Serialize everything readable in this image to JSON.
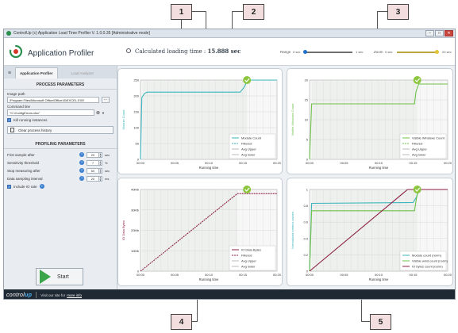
{
  "window": {
    "title": "ControlUp (c) Application Load Time Profiler  V. 1.0.0.35 [Administrative mode]"
  },
  "header": {
    "app_title": "Application Profiler",
    "calc_label": "Calculated loading time :",
    "calc_value": "15.888 sec",
    "range_label": "Range",
    "range_min": "0 sec",
    "range_max": "1 sec",
    "zoom_label": "Zoom",
    "zoom_min": "0 sec",
    "zoom_max": "20 sec"
  },
  "left": {
    "tab_active": "Application Profiler",
    "tab_inactive": "Load Analyzer",
    "process_title": "PROCESS PARAMETERS",
    "image_path_label": "Image path",
    "image_path_value": "\\Program Files\\Microsoft Office\\Office16\\EXCEL.EXE",
    "dots": "...",
    "cmd_label": "Command line",
    "cmd_value": "\"C:\\ConfigErrors.xlsx\"",
    "kill_label": "Kill running instances",
    "clear_label": "Clear process history",
    "profiling_title": "PROFILING PARAMETERS",
    "params": [
      {
        "label": "First sample after",
        "value": "20",
        "unit": "sec"
      },
      {
        "label": "Sensitivity threshold",
        "value": "7",
        "unit": "%"
      },
      {
        "label": "Stop measuring after",
        "value": "60",
        "unit": "sec"
      },
      {
        "label": "Data sampling interval",
        "value": "20",
        "unit": "ms"
      }
    ],
    "include_io_label": "Include IO rate",
    "start_label": "Start"
  },
  "footer": {
    "brand_a": "control",
    "brand_b": "up",
    "visit": "Visit our site for",
    "link": "more info"
  },
  "callouts": [
    "1",
    "2",
    "3",
    "4",
    "5"
  ],
  "colors": {
    "teal": "#3ab5bd",
    "green": "#6fc14a",
    "crimson": "#8b1d45",
    "check": "#8cc63f"
  },
  "chart_data": [
    {
      "type": "line",
      "id": "module",
      "ylabel": "Module Count",
      "xlabel": "Running time",
      "x_ticks": [
        "00:00",
        "00:05",
        "00:10",
        "00:15",
        "00:20"
      ],
      "y_ticks": [
        "0",
        "50",
        "100",
        "150",
        "200",
        "250"
      ],
      "legend": [
        "Module Count",
        "Filtered",
        "Avg Upper",
        "Avg lower"
      ],
      "series": [
        {
          "name": "Module Count",
          "points": [
            [
              0,
              0
            ],
            [
              0.2,
              195
            ],
            [
              0.6,
              208
            ],
            [
              1,
              212
            ],
            [
              14.6,
              212
            ],
            [
              15.2,
              228
            ],
            [
              15.7,
              250
            ],
            [
              20,
              250
            ]
          ]
        }
      ]
    },
    {
      "type": "line",
      "id": "windows",
      "ylabel": "Visible Windows Count",
      "xlabel": "Running time",
      "x_ticks": [
        "00:00",
        "00:05",
        "00:10",
        "00:15",
        "00:20"
      ],
      "y_ticks": [
        "0",
        "5",
        "10",
        "15",
        "20"
      ],
      "legend": [
        "Visible Windows Count",
        "Filtered",
        "Avg Upper",
        "Avg lower"
      ],
      "series": [
        {
          "name": "Visible Windows Count",
          "points": [
            [
              0,
              0
            ],
            [
              0.3,
              14
            ],
            [
              15.2,
              14
            ],
            [
              15.4,
              17
            ],
            [
              15.8,
              19
            ],
            [
              20,
              19
            ]
          ]
        }
      ]
    },
    {
      "type": "line",
      "id": "io",
      "ylabel": "IO Data Bytes",
      "xlabel": "Running time",
      "x_ticks": [
        "00:00",
        "00:05",
        "00:10",
        "00:15",
        "00:20"
      ],
      "y_ticks": [
        "0",
        "10Mb",
        "20Mb",
        "30Mb",
        "40Mb"
      ],
      "legend": [
        "IO Data Bytes",
        "Filtered",
        "Avg Upper",
        "Avg lower"
      ],
      "series": [
        {
          "name": "IO Data Bytes",
          "points": [
            [
              0,
              0
            ],
            [
              14.2,
              38
            ],
            [
              20,
              38
            ]
          ]
        }
      ]
    },
    {
      "type": "line",
      "id": "norm",
      "ylabel": "Normalized metrics values",
      "xlabel": "Running time",
      "x_ticks": [
        "00:00",
        "00:05",
        "00:10",
        "00:15",
        "00:20"
      ],
      "y_ticks": [
        "0",
        "0.2",
        "0.4",
        "0.6",
        "0.8",
        "1"
      ],
      "legend": [
        "Module count (norm)",
        "Visible wind count (norm)",
        "IO bytes count (norm)"
      ],
      "series": [
        {
          "name": "Module count (norm)",
          "points": [
            [
              0,
              0
            ],
            [
              0.3,
              0.83
            ],
            [
              15,
              0.84
            ],
            [
              15.5,
              0.91
            ],
            [
              15.8,
              1
            ],
            [
              20,
              1
            ]
          ]
        },
        {
          "name": "Visible wind count (norm)",
          "points": [
            [
              0,
              0
            ],
            [
              0.3,
              0.74
            ],
            [
              15.2,
              0.74
            ],
            [
              15.5,
              0.9
            ],
            [
              15.8,
              1
            ],
            [
              20,
              1
            ]
          ]
        },
        {
          "name": "IO bytes count (norm)",
          "points": [
            [
              0,
              0
            ],
            [
              14.2,
              1
            ],
            [
              20,
              1
            ]
          ]
        }
      ]
    }
  ]
}
